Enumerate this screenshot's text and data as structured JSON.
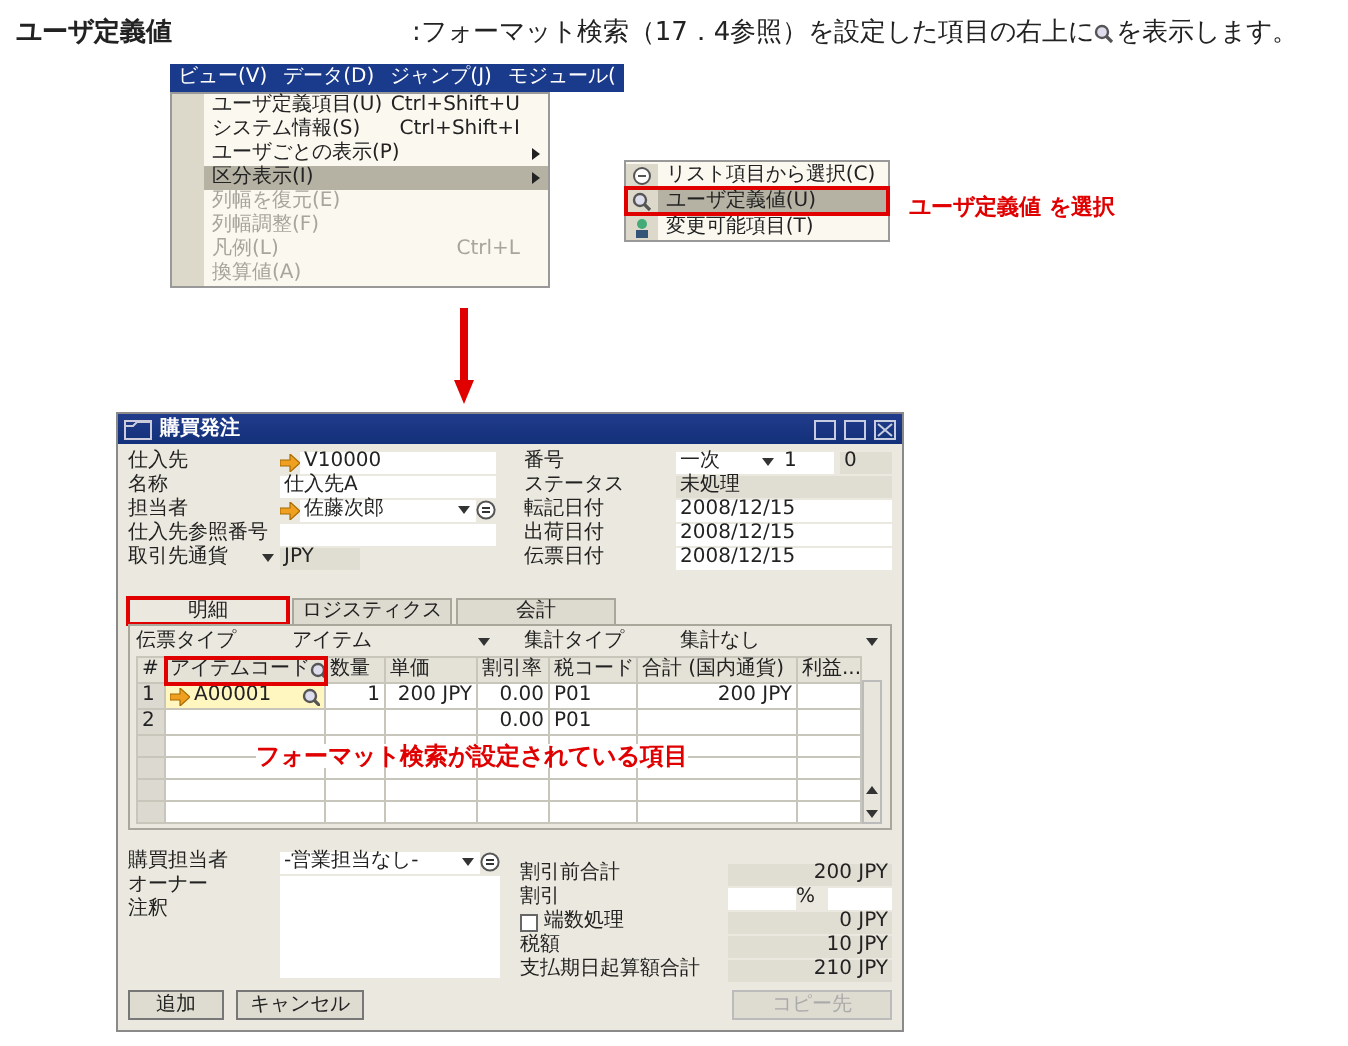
{
  "description": {
    "term": "ユーザ定義値",
    "before": ":フォーマット検索（17．4参照）を設定した項目の右上に",
    "after": "を表示します。"
  },
  "menu": {
    "menubar": [
      "ビュー(V)",
      "データ(D)",
      "ジャンプ(J)",
      "モジュール("
    ],
    "items": [
      {
        "label": "ユーザ定義項目(U)",
        "shortcut": "Ctrl+Shift+U",
        "submenu": false,
        "disabled": false,
        "selected": false
      },
      {
        "label": "システム情報(S)",
        "shortcut": "Ctrl+Shift+I",
        "submenu": false,
        "disabled": false,
        "selected": false
      },
      {
        "label": "ユーザごとの表示(P)",
        "submenu": true,
        "disabled": false,
        "selected": false
      },
      {
        "label": "区分表示(I)",
        "submenu": true,
        "disabled": false,
        "selected": true
      },
      {
        "label": "列幅を復元(E)",
        "submenu": false,
        "disabled": true,
        "selected": false
      },
      {
        "label": "列幅調整(F)",
        "submenu": false,
        "disabled": true,
        "selected": false
      },
      {
        "label": "凡例(L)",
        "shortcut": "Ctrl+L",
        "submenu": false,
        "disabled": true,
        "selected": false
      },
      {
        "label": "換算値(A)",
        "submenu": false,
        "disabled": true,
        "selected": false
      }
    ],
    "submenu": [
      {
        "label": "リスト項目から選択(C)",
        "selected": false,
        "annotated": false
      },
      {
        "label": "ユーザ定義値(U)",
        "selected": true,
        "annotated": true
      },
      {
        "label": "変更可能項目(T)",
        "selected": false,
        "annotated": false
      }
    ],
    "callout": "ユーザ定義値 を選択"
  },
  "dialog": {
    "title": "購買発注",
    "header_left": [
      {
        "kind": "link",
        "label": "仕入先",
        "value": "V10000"
      },
      {
        "kind": "text",
        "label": "名称",
        "value": "仕入先A"
      },
      {
        "kind": "linkselect",
        "label": "担当者",
        "value": "佐藤次郎"
      },
      {
        "kind": "text",
        "label": "仕入先参照番号"
      },
      {
        "kind": "labelselect",
        "label": "取引先通貨",
        "value": "JPY"
      }
    ],
    "header_right": [
      {
        "kind": "series",
        "label": "番号",
        "series": "一次",
        "value": "1",
        "suffix": "0"
      },
      {
        "kind": "readonly",
        "label": "ステータス",
        "value": "未処理"
      },
      {
        "kind": "text",
        "label": "転記日付",
        "value": "2008/12/15"
      },
      {
        "kind": "text",
        "label": "出荷日付",
        "value": "2008/12/15"
      },
      {
        "kind": "text",
        "label": "伝票日付",
        "value": "2008/12/15"
      }
    ],
    "tabs": [
      {
        "label": "明細",
        "selected": true,
        "annotated": true
      },
      {
        "label": "ロジスティクス",
        "selected": false,
        "annotated": false
      },
      {
        "label": "会計",
        "selected": false,
        "annotated": false
      }
    ],
    "document_type": {
      "label": "伝票タイプ",
      "value": "アイテム"
    },
    "summary_type": {
      "label": "集計タイプ",
      "value": "集計なし"
    },
    "table": {
      "columns": [
        {
          "label": "#",
          "search": false,
          "annotated": false
        },
        {
          "label": "アイテムコード",
          "search": true,
          "annotated": true
        },
        {
          "label": "数量",
          "search": false,
          "annotated": false
        },
        {
          "label": "単価",
          "search": false,
          "annotated": false
        },
        {
          "label": "割引率",
          "search": false,
          "annotated": false
        },
        {
          "label": "税コード",
          "search": false,
          "annotated": false
        },
        {
          "label": "合計 (国内通貨)",
          "search": false,
          "annotated": false
        },
        {
          "label": "利益...",
          "search": false,
          "annotated": false
        }
      ],
      "rows": [
        {
          "active": true,
          "cells": [
            "1",
            "A00001",
            "1",
            "200 JPY",
            "0.00",
            "P01",
            "200 JPY",
            null
          ]
        },
        {
          "active": false,
          "cells": [
            "2",
            null,
            null,
            null,
            "0.00",
            "P01",
            null,
            null
          ]
        }
      ]
    },
    "callout": "フォーマット検索が設定されている項目",
    "footer_left": [
      {
        "kind": "select",
        "label": "購買担当者",
        "value": "-営業担当なし-"
      },
      {
        "kind": "text",
        "label": "オーナー"
      },
      {
        "kind": "memo",
        "label": "注釈"
      }
    ],
    "footer_right": [
      {
        "kind": "total",
        "label": "割引前合計",
        "value": "200 JPY"
      },
      {
        "kind": "discount",
        "label": "割引",
        "unit": "%"
      },
      {
        "kind": "checkbox",
        "label": "端数処理",
        "checked": false,
        "value": "0 JPY"
      },
      {
        "kind": "total",
        "label": "税額",
        "value": "10 JPY"
      },
      {
        "kind": "total",
        "label": "支払期日起算額合計",
        "value": "210 JPY"
      }
    ],
    "buttons": [
      {
        "label": "追加",
        "disabled": false
      },
      {
        "label": "キャンセル",
        "disabled": false
      },
      {
        "label": "コピー先",
        "disabled": true
      }
    ]
  }
}
